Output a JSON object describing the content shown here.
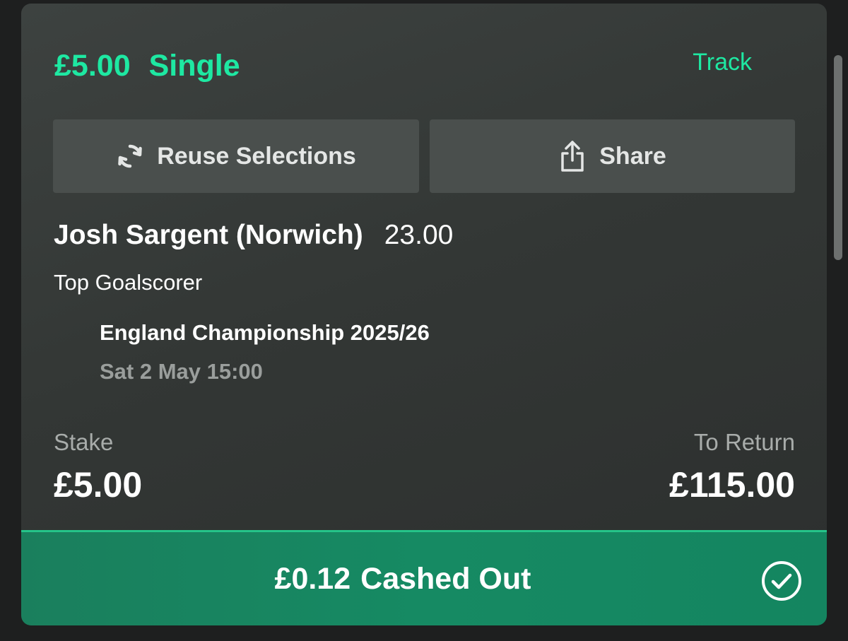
{
  "bet": {
    "stake_amount": "£5.00",
    "bet_type": "Single",
    "track_label": "Track"
  },
  "actions": {
    "reuse_label": "Reuse Selections",
    "share_label": "Share"
  },
  "selection": {
    "name": "Josh Sargent (Norwich)",
    "odds": "23.00",
    "market": "Top Goalscorer",
    "event": "England Championship 2025/26",
    "event_time": "Sat 2 May 15:00"
  },
  "summary": {
    "stake_label": "Stake",
    "stake_value": "£5.00",
    "return_label": "To Return",
    "return_value": "£115.00"
  },
  "cashout": {
    "amount": "£0.12",
    "status": "Cashed Out"
  },
  "icons": {
    "reuse": "refresh-icon",
    "share": "share-icon",
    "cashout": "check-circle-icon"
  },
  "colors": {
    "accent": "#1ee8a2",
    "cashout_bar": "#168a63",
    "card_bg": "#363a38",
    "button_bg": "#4a4f4d",
    "muted_text": "#a8acaa"
  }
}
